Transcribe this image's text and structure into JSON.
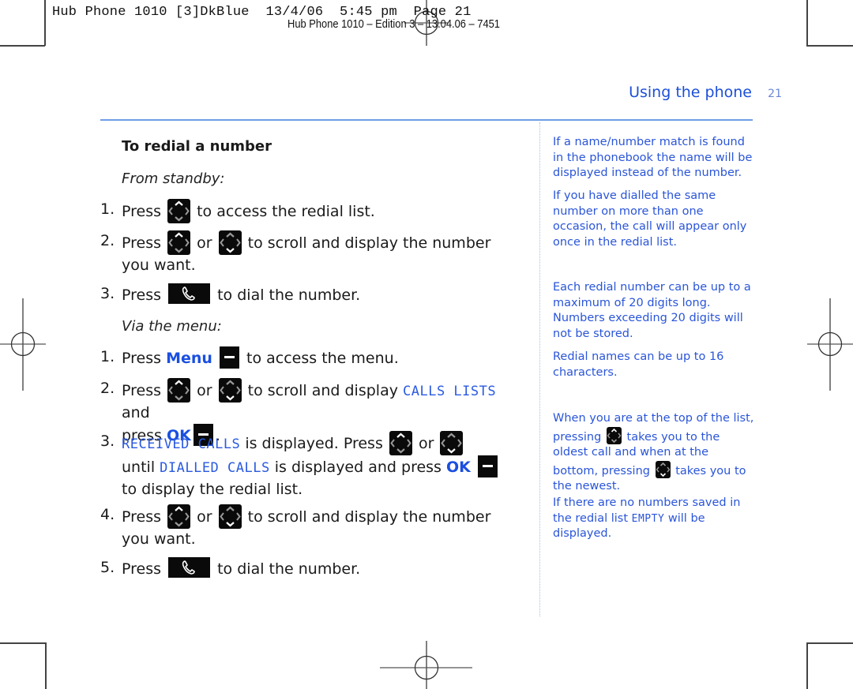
{
  "print_slug": {
    "line1": "Hub Phone 1010 [3]DkBlue  13/4/06  5:45 pm  Page 21",
    "line2": "Hub Phone 1010 – Edition 3 – 13.04.06 – 7451"
  },
  "header": {
    "section_title": "Using the phone",
    "page_number": "21"
  },
  "main": {
    "heading": "To redial a number",
    "from_standby_label": "From standby:",
    "standby_steps": [
      {
        "num": "1.",
        "pre": "Press",
        "post": "to access the redial list."
      },
      {
        "num": "2.",
        "pre": "Press",
        "mid": "or",
        "post": "to scroll and display the number you want."
      },
      {
        "num": "3.",
        "pre": "Press",
        "post": "to dial the number."
      }
    ],
    "via_menu_label": "Via the menu:",
    "menu_steps": [
      {
        "num": "1.",
        "pre": "Press",
        "key_label": "Menu",
        "post": "to access the menu."
      },
      {
        "num": "2.",
        "pre": "Press",
        "mid": "or",
        "post": "to scroll and display",
        "lcd": "CALLS LISTS",
        "tail": "and",
        "line2_pre": "press",
        "key_label": "OK",
        "end": "."
      },
      {
        "num": "3.",
        "lcd": "RECEIVED CALLS",
        "post": "is displayed. Press",
        "mid": "or",
        "line2_pre": "until",
        "lcd2": "DIALLED CALLS",
        "line2_post": "is displayed and press",
        "key_label": "OK",
        "line3": "to display the redial list."
      },
      {
        "num": "4.",
        "pre": "Press",
        "mid": "or",
        "post": "to scroll and display the number you want."
      },
      {
        "num": "5.",
        "pre": "Press",
        "post": "to dial the number."
      }
    ]
  },
  "sidebar": {
    "note1": "If a name/number match is found in the phonebook the name will be displayed instead of the number.",
    "note2": "If you have dialled the same number on more than one occasion, the call will appear only once in the redial list.",
    "note3": "Each redial number can be up to a maximum of 20 digits long. Numbers exceeding 20 digits will not be stored.",
    "note4": "Redial names can be up to 16 characters.",
    "note5_a": "When you are at the top of the list, pressing",
    "note5_b": "takes you to the oldest call and when at the bottom, pressing",
    "note5_c": "takes you to the newest.",
    "note6_a": "If there are no numbers saved in the redial list",
    "note6_lcd": "EMPTY",
    "note6_b": "will be displayed."
  },
  "icons": {
    "nav_key": "navigation-key-icon",
    "call_key": "talk-key-icon",
    "soft_key": "soft-key-icon"
  },
  "colors": {
    "accent_blue": "#1c4fd8",
    "rule_blue": "#6f9de6",
    "sidebar_text": "#2a55d8"
  }
}
